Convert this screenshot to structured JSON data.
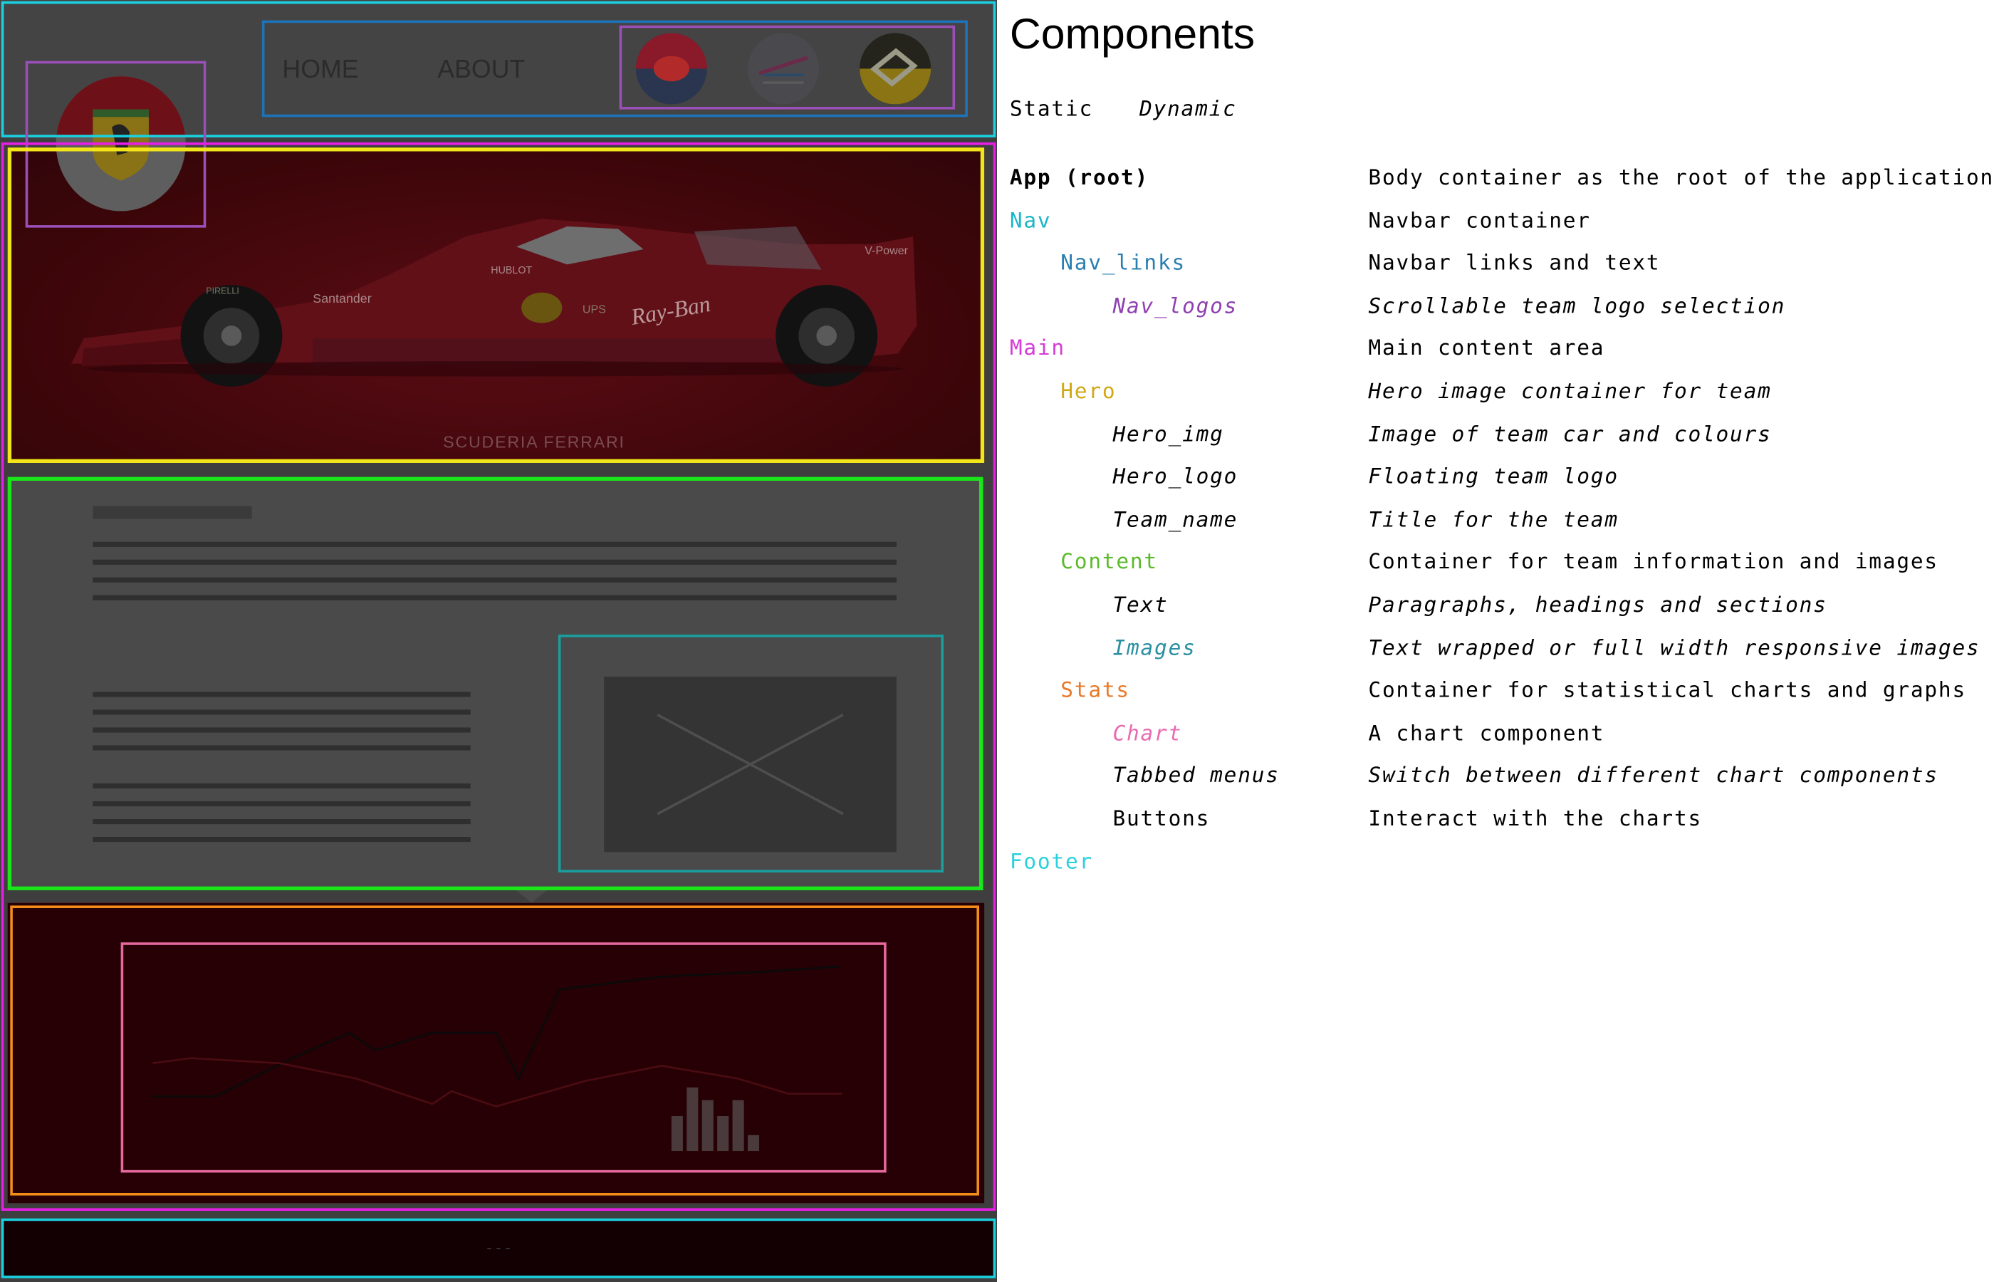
{
  "colors": {
    "nav": "#1ad1e0",
    "nav_links": "#1e73b8",
    "nav_logos": "#9b4fb8",
    "main": "#e61fe6",
    "hero": "#f2e61a",
    "content": "#1ae61a",
    "images": "#1a9e9e",
    "stats": "#f28c1a",
    "chart": "#e6699e",
    "legend_nav": "#1db6c7",
    "legend_nav_links": "#2a7fb0",
    "legend_nav_logos": "#8e3fb0",
    "legend_main": "#d63ad6",
    "legend_hero": "#d1a914",
    "legend_content": "#5aba2a",
    "legend_images": "#2a8fa0",
    "legend_stats": "#e87a2a",
    "legend_chart": "#e86ab0",
    "legend_footer": "#2bd1dc"
  },
  "mockup": {
    "nav_links": [
      "HOME",
      "ABOUT"
    ],
    "team_name": "SCUDERIA FERRARI",
    "footer_text": "- - -",
    "car_sponsors": [
      "Santander",
      "HUBLOT",
      "Ray-Ban",
      "V-Power",
      "PIRELLI",
      "UPS"
    ],
    "chart_bars": [
      0.55,
      1.0,
      0.8,
      0.55,
      0.8,
      0.25
    ]
  },
  "legend": {
    "title": "Components",
    "static_label": "Static",
    "dynamic_label": "Dynamic",
    "rows": [
      {
        "name": "App (root)",
        "desc": "Body container as the root of the application"
      },
      {
        "name": "Nav",
        "desc": "Navbar container"
      },
      {
        "name": "Nav_links",
        "desc": "Navbar links and text"
      },
      {
        "name": "Nav_logos",
        "desc": "Scrollable team logo selection"
      },
      {
        "name": "Main",
        "desc": "Main content area"
      },
      {
        "name": "Hero",
        "desc": "Hero image container for team"
      },
      {
        "name": "Hero_img",
        "desc": "Image of team car and colours"
      },
      {
        "name": "Hero_logo",
        "desc": "Floating team logo"
      },
      {
        "name": "Team_name",
        "desc": "Title for the team"
      },
      {
        "name": "Content",
        "desc": "Container for team information and images"
      },
      {
        "name": "Text",
        "desc": "Paragraphs, headings and sections"
      },
      {
        "name": "Images",
        "desc": "Text wrapped or full width responsive images"
      },
      {
        "name": "Stats",
        "desc": "Container for statistical charts and graphs"
      },
      {
        "name": "Chart",
        "desc": "A chart component"
      },
      {
        "name": "Tabbed menus",
        "desc": "Switch between different chart components"
      },
      {
        "name": "Buttons",
        "desc": "Interact with the charts"
      },
      {
        "name": "Footer",
        "desc": ""
      }
    ]
  }
}
